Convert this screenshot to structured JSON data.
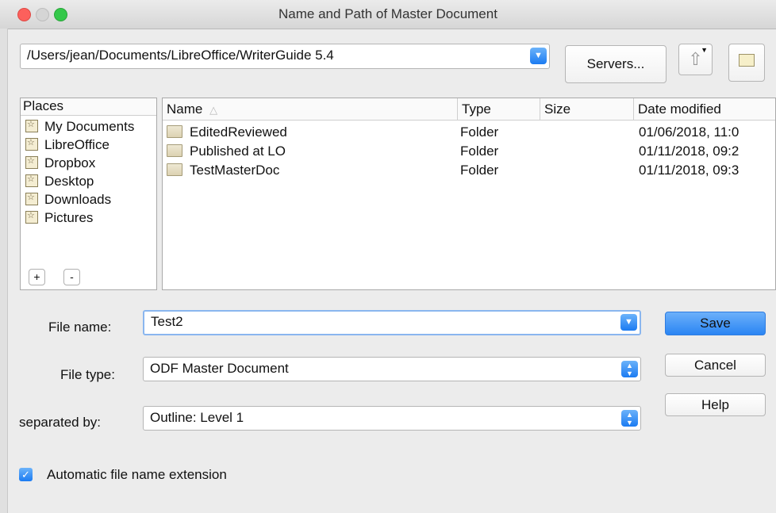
{
  "window": {
    "title": "Name and Path of Master Document"
  },
  "path_bar": {
    "value": "/Users/jean/Documents/LibreOffice/WriterGuide 5.4",
    "servers_label": "Servers..."
  },
  "toolbar": {
    "up_icon": "up-level-icon",
    "new_folder_icon": "new-folder-icon"
  },
  "places": {
    "header": "Places",
    "items": [
      {
        "label": "My Documents"
      },
      {
        "label": "LibreOffice"
      },
      {
        "label": "Dropbox"
      },
      {
        "label": "Desktop"
      },
      {
        "label": "Downloads"
      },
      {
        "label": "Pictures"
      }
    ],
    "add_label": "+",
    "remove_label": "-"
  },
  "files": {
    "columns": {
      "name": "Name",
      "type": "Type",
      "size": "Size",
      "date": "Date modified"
    },
    "rows": [
      {
        "name": "EditedReviewed",
        "type": "Folder",
        "size": "",
        "date": "01/06/2018, 11:0"
      },
      {
        "name": "Published at LO",
        "type": "Folder",
        "size": "",
        "date": "01/11/2018, 09:2"
      },
      {
        "name": "TestMasterDoc",
        "type": "Folder",
        "size": "",
        "date": "01/11/2018, 09:3"
      }
    ]
  },
  "form": {
    "file_name_label": "File name:",
    "file_name_value": "Test2",
    "file_type_label": "File type:",
    "file_type_value": "ODF Master Document",
    "separated_label": "separated by:",
    "separated_value": "Outline: Level 1",
    "auto_ext_label": "Automatic file name extension",
    "auto_ext_checked": true
  },
  "buttons": {
    "save": "Save",
    "cancel": "Cancel",
    "help": "Help"
  },
  "colors": {
    "accent": "#2a85f3"
  }
}
